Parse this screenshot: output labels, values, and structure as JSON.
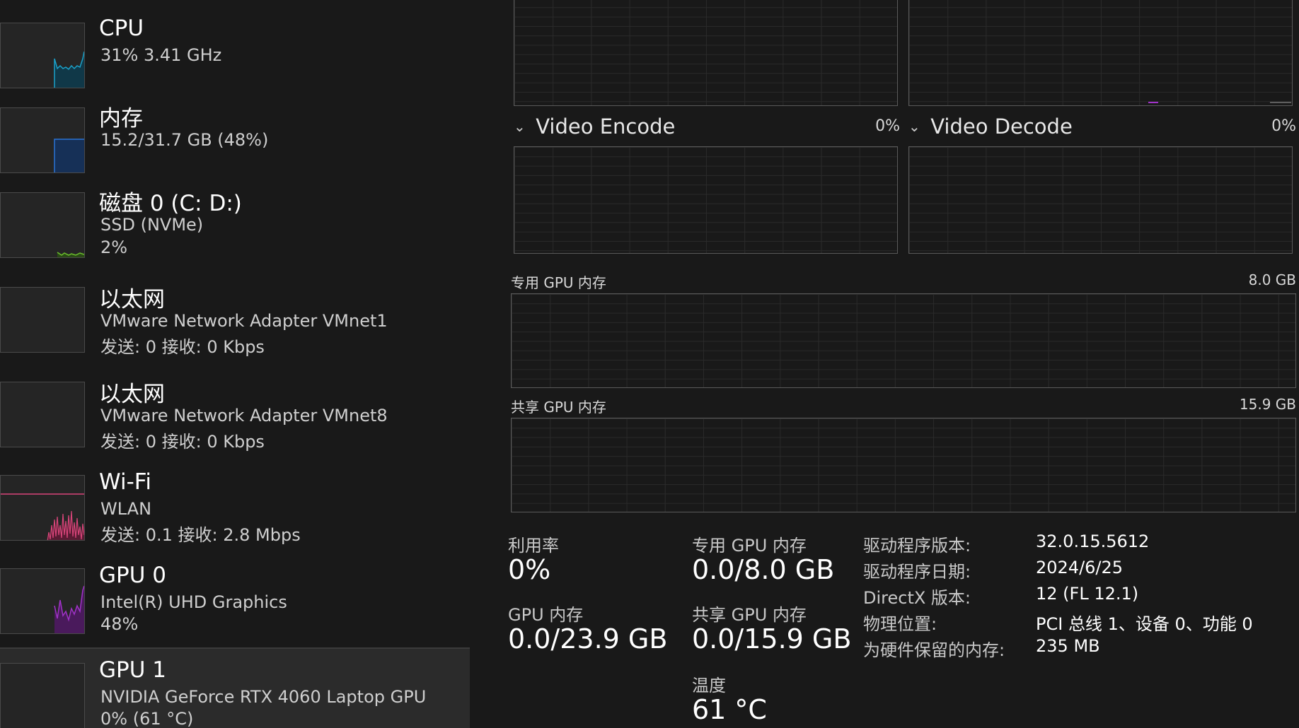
{
  "sidebar": {
    "items": [
      {
        "title": "CPU",
        "line1": "31%  3.41 GHz",
        "line2": "",
        "accent": "#1ba1c9"
      },
      {
        "title": "内存",
        "line1": "15.2/31.7 GB (48%)",
        "line2": "",
        "accent": "#1f5fb8"
      },
      {
        "title": "磁盘 0 (C: D:)",
        "line1": "SSD (NVMe)",
        "line2": "2%",
        "accent": "#6bbf2c"
      },
      {
        "title": "以太网",
        "line1": "VMware Network Adapter VMnet1",
        "line2": "发送: 0  接收: 0 Kbps",
        "accent": "#a0a0a0"
      },
      {
        "title": "以太网",
        "line1": "VMware Network Adapter VMnet8",
        "line2": "发送: 0  接收: 0 Kbps",
        "accent": "#a0a0a0"
      },
      {
        "title": "Wi-Fi",
        "line1": "WLAN",
        "line2": "发送: 0.1  接收: 2.8 Mbps",
        "accent": "#d9457a"
      },
      {
        "title": "GPU 0",
        "line1": "Intel(R) UHD Graphics",
        "line2": "48%",
        "accent": "#a032c8"
      },
      {
        "title": "GPU 1",
        "line1": "NVIDIA GeForce RTX 4060 Laptop GPU",
        "line2": "0%  (61 °C)",
        "accent": "#a0a0a0"
      }
    ]
  },
  "engines": {
    "encode": {
      "label": "Video Encode",
      "pct": "0%"
    },
    "decode": {
      "label": "Video Decode",
      "pct": "0%"
    }
  },
  "memory": {
    "dedicated": {
      "label": "专用 GPU 内存",
      "max": "8.0 GB"
    },
    "shared": {
      "label": "共享 GPU 内存",
      "max": "15.9 GB"
    }
  },
  "stats": {
    "utilization": {
      "label": "利用率",
      "value": "0%"
    },
    "dedicated": {
      "label": "专用 GPU 内存",
      "value": "0.0/8.0 GB"
    },
    "gpu_mem": {
      "label": "GPU 内存",
      "value": "0.0/23.9 GB"
    },
    "shared": {
      "label": "共享 GPU 内存",
      "value": "0.0/15.9 GB"
    },
    "temperature": {
      "label": "温度",
      "value": "61 °C"
    }
  },
  "info": [
    {
      "label": "驱动程序版本:",
      "value": "32.0.15.5612"
    },
    {
      "label": "驱动程序日期:",
      "value": "2024/6/25"
    },
    {
      "label": "DirectX 版本:",
      "value": "12 (FL 12.1)"
    },
    {
      "label": "物理位置:",
      "value": "PCI 总线 1、设备 0、功能 0"
    },
    {
      "label": "为硬件保留的内存:",
      "value": "235 MB"
    }
  ]
}
